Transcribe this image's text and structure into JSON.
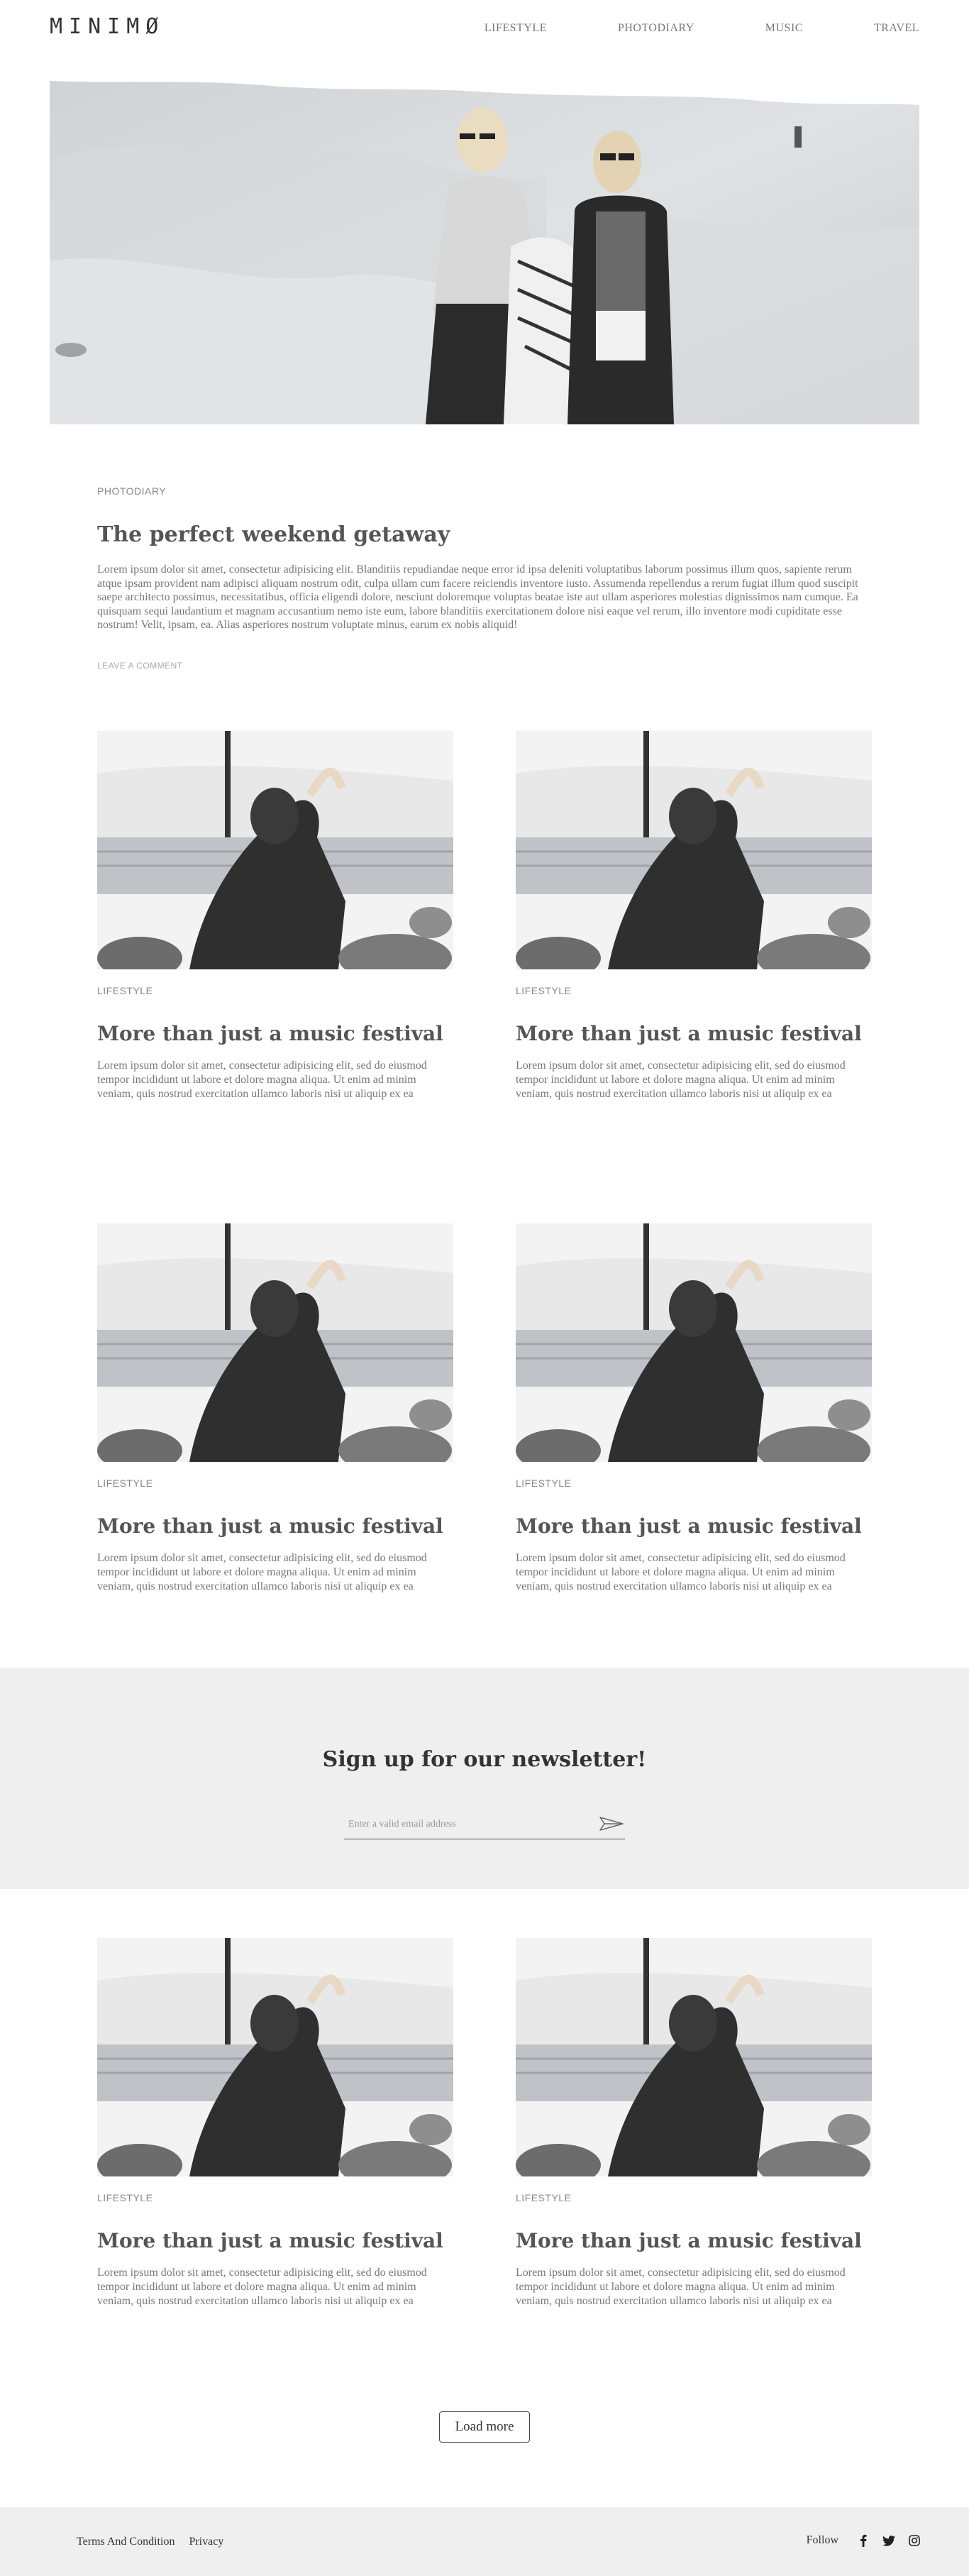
{
  "header": {
    "logo": "MINIMØ",
    "nav": [
      "LIFESTYLE",
      "PHOTODIARY",
      "MUSIC",
      "TRAVEL"
    ]
  },
  "featured": {
    "category": "PHOTODIARY",
    "title": "The perfect weekend getaway",
    "body": "Lorem ipsum dolor sit amet, consectetur adipisicing elit. Blanditiis repudiandae neque error id ipsa deleniti voluptatibus laborum possimus illum quos, sapiente rerum atque ipsam provident nam adipisci aliquam nostrum odit, culpa ullam cum facere reiciendis inventore iusto. Assumenda repellendus a rerum fugiat illum quod suscipit saepe architecto possimus, necessitatibus, officia eligendi dolore, nesciunt doloremque voluptas beatae iste aut ullam asperiores molestias dignissimos nam cumque. Ea quisquam sequi laudantium et magnam accusantium nemo iste eum, labore blanditiis exercitationem dolore nisi eaque vel rerum, illo inventore modi cupiditate esse nostrum! Velit, ipsam, ea. Alias asperiores nostrum voluptate minus, earum ex nobis aliquid!",
    "comment_link": "LEAVE A COMMENT"
  },
  "posts": [
    {
      "category": "LIFESTYLE",
      "title": "More than just a music festival",
      "body": "Lorem ipsum dolor sit amet, consectetur adipisicing elit, sed do eiusmod tempor incididunt ut labore et dolore magna aliqua. Ut enim ad minim veniam, quis nostrud exercitation ullamco laboris nisi ut aliquip ex ea"
    },
    {
      "category": "LIFESTYLE",
      "title": "More than just a music festival",
      "body": "Lorem ipsum dolor sit amet, consectetur adipisicing elit, sed do eiusmod tempor incididunt ut labore et dolore magna aliqua. Ut enim ad minim veniam, quis nostrud exercitation ullamco laboris nisi ut aliquip ex ea"
    },
    {
      "category": "LIFESTYLE",
      "title": "More than just a music festival",
      "body": "Lorem ipsum dolor sit amet, consectetur adipisicing elit, sed do eiusmod tempor incididunt ut labore et dolore magna aliqua. Ut enim ad minim veniam, quis nostrud exercitation ullamco laboris nisi ut aliquip ex ea"
    },
    {
      "category": "LIFESTYLE",
      "title": "More than just a music festival",
      "body": "Lorem ipsum dolor sit amet, consectetur adipisicing elit, sed do eiusmod tempor incididunt ut labore et dolore magna aliqua. Ut enim ad minim veniam, quis nostrud exercitation ullamco laboris nisi ut aliquip ex ea"
    },
    {
      "category": "LIFESTYLE",
      "title": "More than just a music festival",
      "body": "Lorem ipsum dolor sit amet, consectetur adipisicing elit, sed do eiusmod tempor incididunt ut labore et dolore magna aliqua. Ut enim ad minim veniam, quis nostrud exercitation ullamco laboris nisi ut aliquip ex ea"
    },
    {
      "category": "LIFESTYLE",
      "title": "More than just a music festival",
      "body": "Lorem ipsum dolor sit amet, consectetur adipisicing elit, sed do eiusmod tempor incididunt ut labore et dolore magna aliqua. Ut enim ad minim veniam, quis nostrud exercitation ullamco laboris nisi ut aliquip ex ea"
    }
  ],
  "newsletter": {
    "title": "Sign up for our newsletter!",
    "placeholder": "Enter a valid email address",
    "send_icon": "send-arrow-icon"
  },
  "load_more": "Load more",
  "footer": {
    "links": [
      "Terms And Condition",
      "Privacy"
    ],
    "follow": "Follow",
    "social_icons": [
      "facebook-icon",
      "twitter-icon",
      "instagram-icon"
    ]
  },
  "colors": {
    "text": "#555555",
    "muted": "#777777",
    "band_bg": "#efefef"
  }
}
